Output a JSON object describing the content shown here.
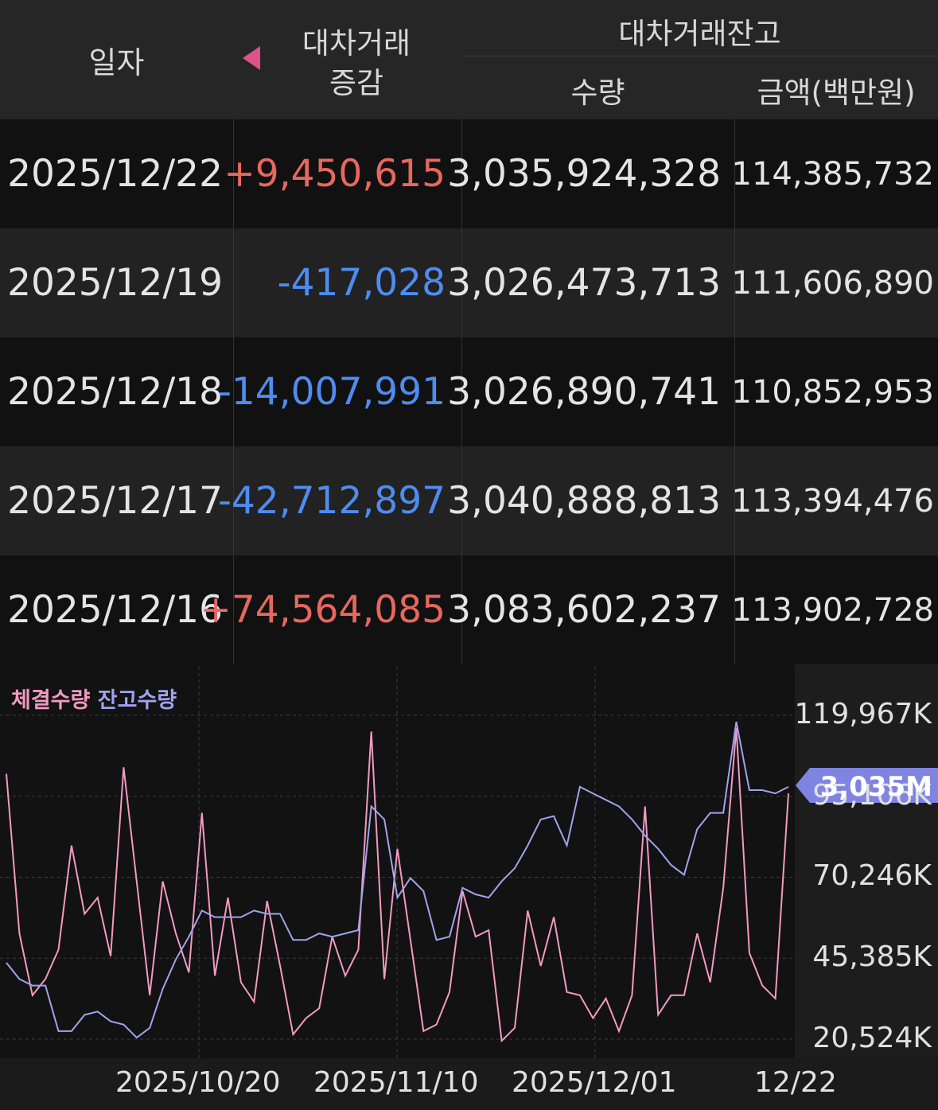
{
  "header": {
    "date": "일자",
    "change_line1": "대차거래",
    "change_line2": "증감",
    "group": "대차거래잔고",
    "qty": "수량",
    "amount": "금액(백만원)"
  },
  "rows": [
    {
      "date": "2025/12/22",
      "change": "+9,450,615",
      "qty": "3,035,924,328",
      "amount": "114,385,732"
    },
    {
      "date": "2025/12/19",
      "change": "-417,028",
      "qty": "3,026,473,713",
      "amount": "111,606,890"
    },
    {
      "date": "2025/12/18",
      "change": "-14,007,991",
      "qty": "3,026,890,741",
      "amount": "110,852,953"
    },
    {
      "date": "2025/12/17",
      "change": "-42,712,897",
      "qty": "3,040,888,813",
      "amount": "113,394,476"
    },
    {
      "date": "2025/12/16",
      "change": "+74,564,085",
      "qty": "3,083,602,237",
      "amount": "113,902,728"
    }
  ],
  "colors": {
    "positive": "#e8675f",
    "negative": "#4f8cf0",
    "pink": "#f29ac2",
    "purple": "#9fa3ee"
  },
  "chart_data": {
    "type": "line",
    "legend": [
      "체결수량",
      "잔고수량"
    ],
    "y_ticks": [
      "119,967K",
      "95,106K",
      "70,246K",
      "45,385K",
      "20,524K"
    ],
    "y_tick_values": [
      119967,
      95106,
      70246,
      45385,
      20524
    ],
    "x_ticks": [
      "2025/10/20",
      "2025/11/10",
      "2025/12/01",
      "12/22"
    ],
    "current_badge": "3,035M",
    "series": [
      {
        "name": "체결수량",
        "values": [
          102000,
          53000,
          34000,
          39000,
          48000,
          80000,
          59000,
          64000,
          46000,
          104000,
          69000,
          34000,
          69000,
          53000,
          41000,
          90000,
          40000,
          64000,
          38000,
          32000,
          63000,
          43000,
          22000,
          27000,
          30000,
          52000,
          40000,
          48000,
          115000,
          39000,
          79000,
          51000,
          23000,
          25000,
          35000,
          66000,
          52000,
          54000,
          20000,
          24000,
          60000,
          43000,
          58000,
          35000,
          34000,
          27000,
          33000,
          23000,
          34000,
          92000,
          28000,
          34000,
          34000,
          53000,
          38000,
          67000,
          116000,
          47000,
          37000,
          33000,
          96000
        ]
      },
      {
        "name": "잔고수량",
        "values": [
          44000,
          39000,
          37000,
          37000,
          23000,
          23000,
          28000,
          29000,
          26000,
          25000,
          21000,
          24000,
          36000,
          45000,
          52000,
          60000,
          58000,
          58000,
          58000,
          60000,
          59000,
          59000,
          51000,
          51000,
          53000,
          52000,
          53000,
          54000,
          92000,
          88000,
          64000,
          70000,
          66000,
          51000,
          52000,
          67000,
          65000,
          64000,
          69000,
          73000,
          80000,
          88000,
          89000,
          80000,
          98000,
          96000,
          94000,
          92000,
          88000,
          83000,
          79000,
          74000,
          71000,
          85000,
          90000,
          90000,
          118000,
          97000,
          97000,
          96000,
          98000
        ]
      }
    ]
  }
}
